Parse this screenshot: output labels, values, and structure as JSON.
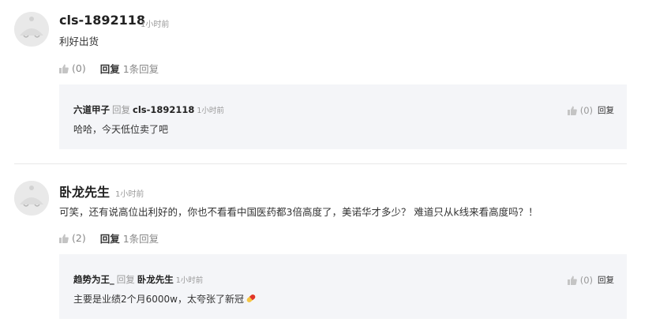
{
  "comments": [
    {
      "username": "cls-1892118",
      "time": "1小时前",
      "content": "利好出货",
      "like_count": "(0)",
      "reply_label": "回复",
      "reply_count": "1条回复",
      "reply": {
        "author": "六道甲子",
        "verb": "回复",
        "target": "cls-1892118",
        "time": "1小时前",
        "text": "哈哈，今天低位卖了吧",
        "like_count": "(0)",
        "reply_label": "回复"
      }
    },
    {
      "username": "卧龙先生",
      "time": "1小时前",
      "content": "可笑，还有说高位出利好的，你也不看看中国医药都3倍高度了，美诺华才多少？ 难道只从k线来看高度吗？！",
      "like_count": "(2)",
      "reply_label": "回复",
      "reply_count": "1条回复",
      "reply": {
        "author": "趋势为王_",
        "verb": "回复",
        "target": "卧龙先生",
        "time": "1小时前",
        "text": "主要是业绩2个月6000w，太夸张了新冠",
        "like_count": "(0)",
        "reply_label": "回复"
      }
    }
  ]
}
